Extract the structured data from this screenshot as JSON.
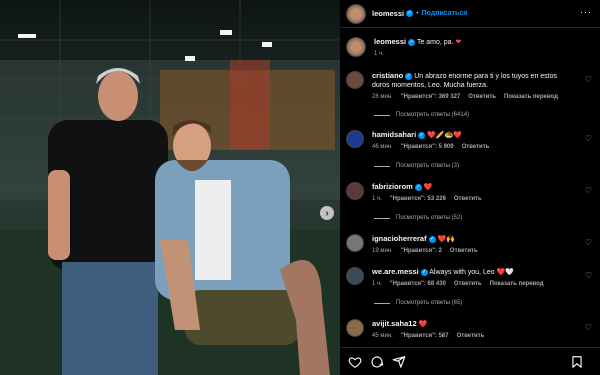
{
  "post": {
    "author": "leomessi",
    "follow_label": "Подписаться",
    "separator": "•",
    "more_icon": "more-horizontal-icon"
  },
  "caption": {
    "user": "leomessi",
    "text": "Te amo, pa.",
    "time": "1 ч."
  },
  "comments": [
    {
      "user": "cristiano",
      "verified": true,
      "text": "Un abrazo enorme para ti y los tuyos en estos duros momentos, Leo. Mucha fuerza.",
      "time": "28 мин.",
      "likes": "\"Нравится\": 369 327",
      "reply": "Ответить",
      "translate": "Показать перевод",
      "replies": "Посмотреть ответы (6414)"
    },
    {
      "user": "hamidsahari",
      "verified": true,
      "text": "",
      "emoji": "❤️🥖🧆❤️",
      "time": "46 мин.",
      "likes": "\"Нравится\": 5 909",
      "reply": "Ответить",
      "translate": "",
      "replies": "Посмотреть ответы (3)"
    },
    {
      "user": "fabriziorom",
      "verified": true,
      "text": "",
      "emoji": "❤️",
      "time": "1 ч.",
      "likes": "\"Нравится\": 53 226",
      "reply": "Ответить",
      "translate": "",
      "replies": "Посмотреть ответы (52)"
    },
    {
      "user": "ignacioherreraf",
      "verified": true,
      "text": "",
      "emoji": "❤️🙌",
      "time": "19 мин.",
      "likes": "\"Нравится\": 2",
      "reply": "Ответить",
      "translate": "",
      "replies": ""
    },
    {
      "user": "we.are.messi",
      "verified": true,
      "text": "Always with you, Leo",
      "emoji": "❤️🤍",
      "time": "1 ч.",
      "likes": "\"Нравится\": 68 430",
      "reply": "Ответить",
      "translate": "Показать перевод",
      "replies": "Посмотреть ответы (65)"
    },
    {
      "user": "avijit.saha12",
      "verified": false,
      "text": "",
      "emoji": "❤️",
      "time": "45 мин.",
      "likes": "\"Нравится\": 587",
      "reply": "Ответить",
      "translate": "",
      "replies": ""
    }
  ],
  "footer": {
    "icons": [
      "heart-icon",
      "comment-icon",
      "share-icon",
      "bookmark-icon"
    ]
  },
  "colors": {
    "accent": "#0095f6",
    "heart": "#ed4956",
    "bg": "#000000",
    "muted": "#a8a8a8"
  }
}
